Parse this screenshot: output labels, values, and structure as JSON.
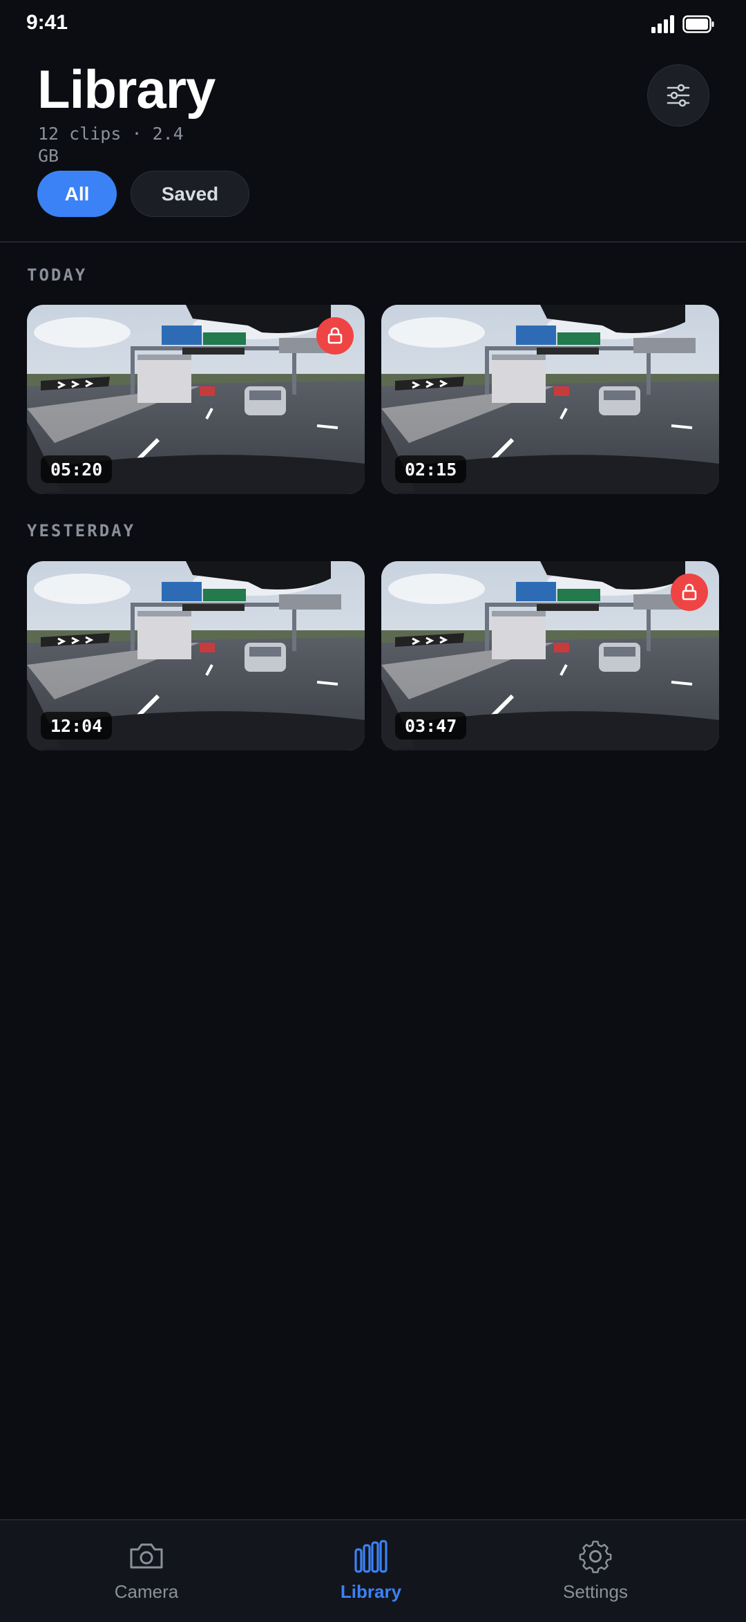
{
  "status_bar": {
    "time": "9:41"
  },
  "header": {
    "title": "Library",
    "subtitle": "12 clips · 2.4 GB",
    "filter_icon": "sliders-icon"
  },
  "filters": [
    {
      "label": "All",
      "active": true
    },
    {
      "label": "Saved",
      "active": false
    }
  ],
  "sections": [
    {
      "label": "TODAY",
      "clips": [
        {
          "duration": "05:20",
          "locked": true
        },
        {
          "duration": "02:15",
          "locked": false
        }
      ]
    },
    {
      "label": "YESTERDAY",
      "clips": [
        {
          "duration": "12:04",
          "locked": false
        },
        {
          "duration": "03:47",
          "locked": true
        }
      ]
    }
  ],
  "tab_bar": [
    {
      "label": "Camera",
      "icon": "camera-icon",
      "active": false
    },
    {
      "label": "Library",
      "icon": "library-icon",
      "active": true
    },
    {
      "label": "Settings",
      "icon": "gear-icon",
      "active": false
    }
  ],
  "colors": {
    "background": "#0b0d12",
    "accent": "#3b82f6",
    "lock_badge": "#ef4444"
  }
}
